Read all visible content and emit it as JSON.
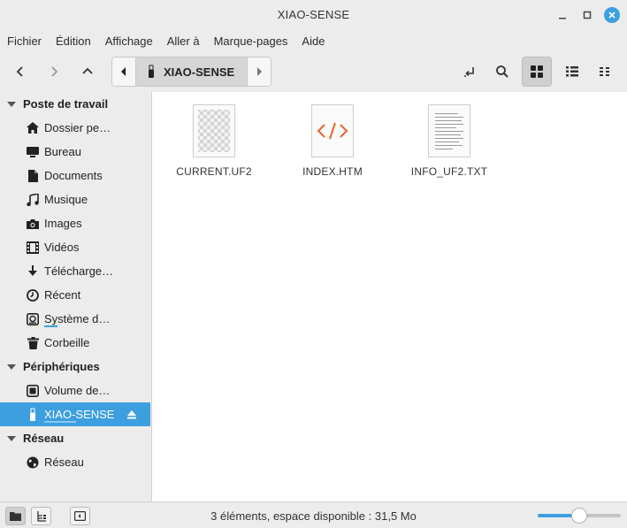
{
  "window": {
    "title": "XIAO-SENSE"
  },
  "menu": [
    "Fichier",
    "Édition",
    "Affichage",
    "Aller à",
    "Marque-pages",
    "Aide"
  ],
  "path": {
    "crumb": "XIAO-SENSE"
  },
  "sidebar": {
    "sections": [
      {
        "title": "Poste de travail",
        "items": [
          {
            "label": "Dossier pe…",
            "icon": "home-icon"
          },
          {
            "label": "Bureau",
            "icon": "desktop-icon"
          },
          {
            "label": "Documents",
            "icon": "document-icon"
          },
          {
            "label": "Musique",
            "icon": "music-icon"
          },
          {
            "label": "Images",
            "icon": "camera-icon"
          },
          {
            "label": "Vidéos",
            "icon": "film-icon"
          },
          {
            "label": "Télécharge…",
            "icon": "download-icon"
          },
          {
            "label": "Récent",
            "icon": "clock-icon"
          },
          {
            "label": "Système d…",
            "icon": "drive-icon",
            "usage": 0.2
          },
          {
            "label": "Corbeille",
            "icon": "trash-icon"
          }
        ]
      },
      {
        "title": "Périphériques",
        "items": [
          {
            "label": "Volume de…",
            "icon": "drive-icon"
          },
          {
            "label": "XIAO-SENSE",
            "icon": "usb-icon",
            "selected": true,
            "usage": 0.5
          }
        ]
      },
      {
        "title": "Réseau",
        "items": [
          {
            "label": "Réseau",
            "icon": "globe-icon"
          }
        ]
      }
    ]
  },
  "files": [
    {
      "name": "CURRENT.UF2",
      "icon": "binary-file-icon"
    },
    {
      "name": "INDEX.HTM",
      "icon": "html-file-icon"
    },
    {
      "name": "INFO_UF2.TXT",
      "icon": "text-file-icon"
    }
  ],
  "status": {
    "text": "3 éléments, espace disponible : 31,5 Mo",
    "zoom_level": 0.5
  },
  "colors": {
    "accent": "#3d9fdf",
    "html_icon": "#e8642c"
  }
}
